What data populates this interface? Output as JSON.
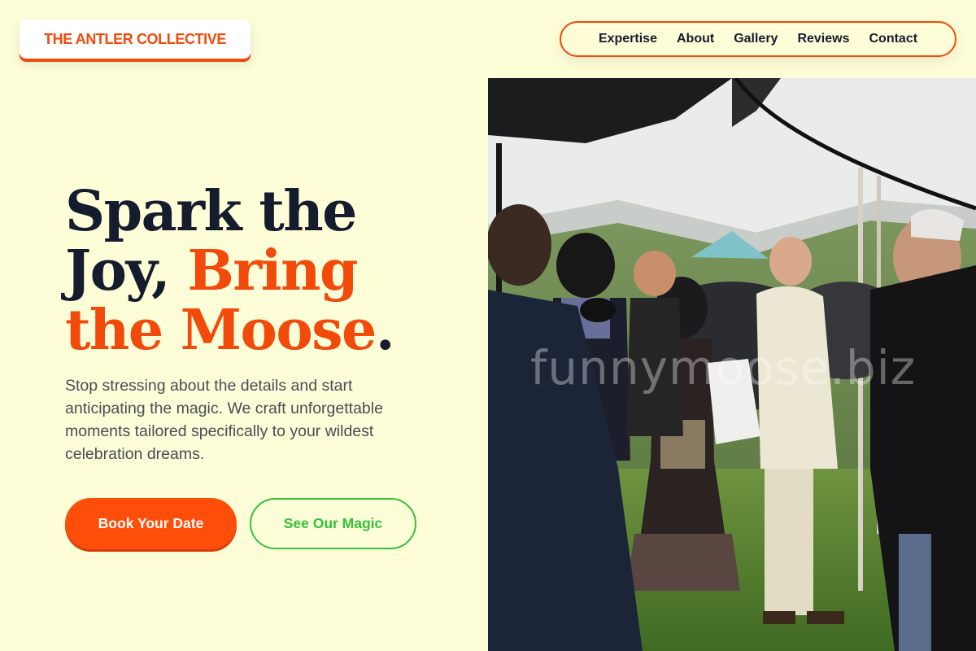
{
  "header": {
    "logo_text": "THE ANTLER COLLECTIVE",
    "nav": [
      "Expertise",
      "About",
      "Gallery",
      "Reviews",
      "Contact"
    ]
  },
  "hero": {
    "headline_part1": "Spark the Joy, ",
    "headline_accent": "Bring the Moose",
    "headline_end": ".",
    "subtext": "Stop stressing about the details and start anticipating the magic. We craft unforgettable moments tailored specifically to your wildest celebration dreams.",
    "primary_button": "Book Your Date",
    "secondary_button": "See Our Magic"
  },
  "photo": {
    "watermark": "funnymoose.biz"
  },
  "colors": {
    "background": "#fdfdd8",
    "accent": "#f24a0a",
    "primary_button": "#ff4d0a",
    "secondary": "#33c23a",
    "text": "#151c2e"
  }
}
